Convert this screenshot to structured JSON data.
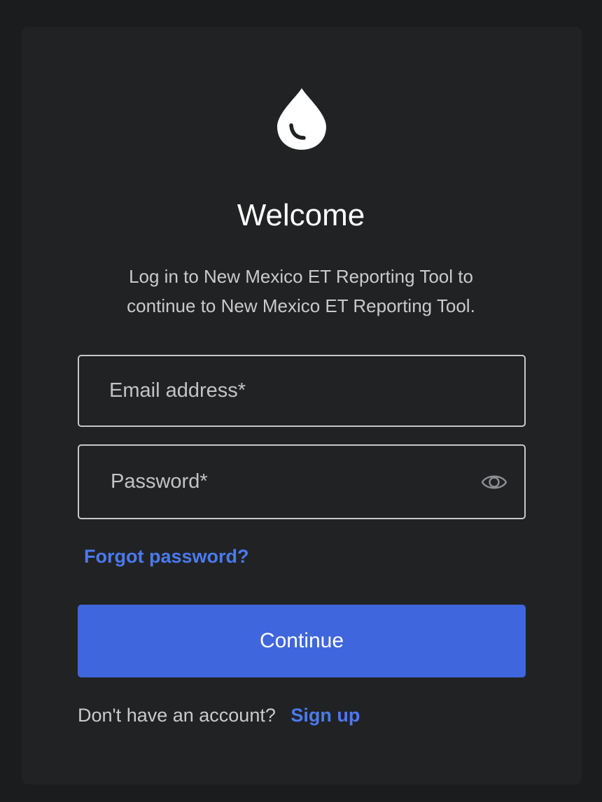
{
  "logo": {
    "icon": "water-drop-icon"
  },
  "header": {
    "title": "Welcome",
    "subtitle_line1": "Log in to New Mexico ET Reporting Tool to",
    "subtitle_line2": "continue to New Mexico ET Reporting Tool."
  },
  "form": {
    "email": {
      "placeholder": "Email address*",
      "value": ""
    },
    "password": {
      "placeholder": "Password*",
      "value": "",
      "toggle_icon": "eye-icon"
    },
    "forgot_password": "Forgot password?",
    "continue_label": "Continue"
  },
  "footer": {
    "prompt": "Don't have an account?",
    "signup_label": "Sign up"
  },
  "colors": {
    "background": "#1b1c1e",
    "card": "#212224",
    "accent": "#3f66dc",
    "link": "#4a7af0",
    "border": "#c6c7c9"
  }
}
